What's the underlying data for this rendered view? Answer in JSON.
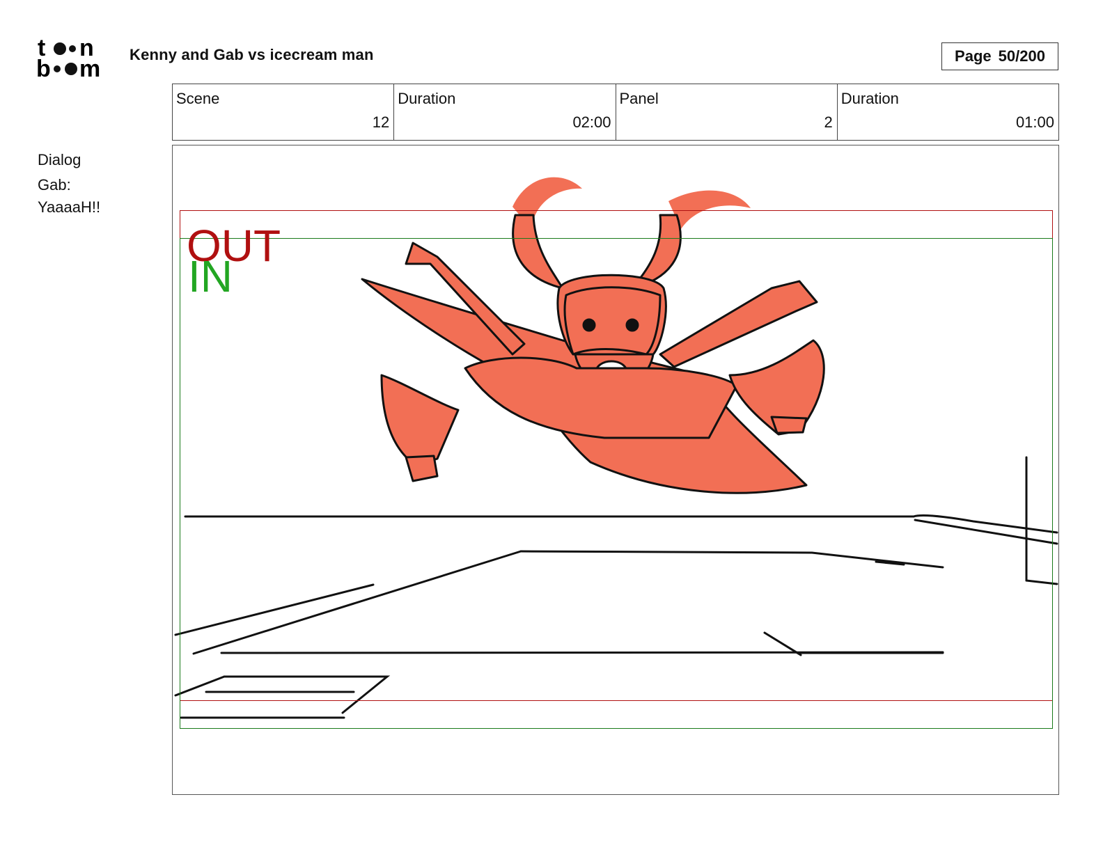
{
  "header": {
    "logo_text": "toonboom",
    "project_title": "Kenny and Gab vs icecream man",
    "page_label": "Page",
    "page_number": "50/200"
  },
  "info": {
    "scene_label": "Scene",
    "scene_value": "12",
    "scene_duration_label": "Duration",
    "scene_duration_value": "02:00",
    "panel_label": "Panel",
    "panel_value": "2",
    "panel_duration_label": "Duration",
    "panel_duration_value": "01:00"
  },
  "dialog": {
    "heading": "Dialog",
    "speaker": "Gab:",
    "line": "YaaaaH!!"
  },
  "panel": {
    "frame_out_label": "OUT",
    "frame_in_label": "IN",
    "colors": {
      "frame_out": "#b01010",
      "frame_in": "#22a622",
      "character_fill": "#f26f55",
      "ink": "#111111"
    }
  }
}
